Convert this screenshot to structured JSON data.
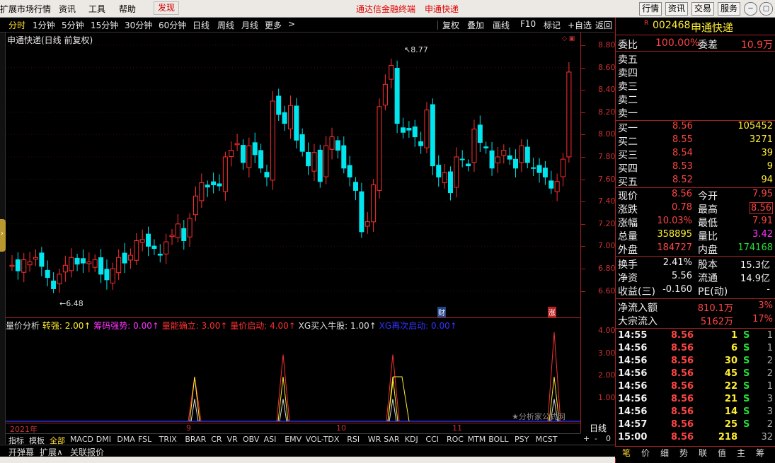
{
  "menu": {
    "items": [
      "扩展市场行情",
      "资讯",
      "工具",
      "帮助"
    ],
    "discover": "发现",
    "center_left": "通达信金融终端",
    "center_right": "申通快递",
    "right_buttons": [
      "行情",
      "资讯",
      "交易",
      "服务"
    ]
  },
  "periods": [
    "分时",
    "1分钟",
    "5分钟",
    "15分钟",
    "30分钟",
    "60分钟",
    "日线",
    "周线",
    "月线",
    "更多"
  ],
  "period_more_arrow": ">",
  "tools": [
    "复权",
    "叠加",
    "画线",
    "F10",
    "标记",
    "+自选",
    "返回"
  ],
  "chart_title": "申通快递(日线 前复权)",
  "high_label": "8.77",
  "low_label": "6.48",
  "cai_tag": "财",
  "zhang_tag": "涨",
  "indicator": {
    "name": "量价分析",
    "items": [
      {
        "label": "转强: 2.00",
        "color": "#ffee33"
      },
      {
        "label": "筹码强势: 0.00",
        "color": "#ff33ff"
      },
      {
        "label": "量能确立: 3.00",
        "color": "#ff3030"
      },
      {
        "label": "量价启动: 4.00",
        "color": "#ff3030"
      },
      {
        "label": "XG买入牛股: 1.00",
        "color": "#dddddd"
      },
      {
        "label": "XG再次启动: 0.00",
        "color": "#3333ff"
      }
    ],
    "watermark": "★分析家公式网"
  },
  "axis_main": [
    "8.80",
    "8.60",
    "8.40",
    "8.20",
    "8.00",
    "7.80",
    "7.60",
    "7.40",
    "7.20",
    "7.00",
    "6.80",
    "6.60"
  ],
  "axis_ind": [
    "4.00",
    "3.00",
    "2.00",
    "1.00"
  ],
  "dates": [
    "2021年",
    "9",
    "10",
    "11"
  ],
  "period_label": "日线",
  "tabs": [
    "指标",
    "模板",
    "全部",
    "MACD",
    "DMI",
    "DMA",
    "FSL",
    "TRIX",
    "BRAR",
    "CR",
    "VR",
    "OBV",
    "ASI",
    "EMV",
    "VOL-TDX",
    "RSI",
    "WR",
    "SAR",
    "KDJ",
    "CCI",
    "ROC",
    "MTM",
    "BOLL",
    "PSY",
    "MCST"
  ],
  "tab_controls": [
    "+",
    "-",
    "0"
  ],
  "bottom_buttons": [
    "开弹幕",
    "扩展∧",
    "关联报价"
  ],
  "stock": {
    "r_flag": "R",
    "code": "002468",
    "name": "申通快递"
  },
  "weibi": {
    "label": "委比",
    "value": "100.00%",
    "label2": "委差",
    "value2": "10.9万"
  },
  "sells": [
    "卖五",
    "卖四",
    "卖三",
    "卖二",
    "卖一"
  ],
  "buys": [
    {
      "label": "买一",
      "price": "8.56",
      "vol": "105452"
    },
    {
      "label": "买二",
      "price": "8.55",
      "vol": "3271"
    },
    {
      "label": "买三",
      "price": "8.54",
      "vol": "39"
    },
    {
      "label": "买四",
      "price": "8.53",
      "vol": "9"
    },
    {
      "label": "买五",
      "price": "8.52",
      "vol": "94"
    }
  ],
  "quote": [
    {
      "l1": "现价",
      "v1": "8.56",
      "c1": "red",
      "l2": "今开",
      "v2": "7.95",
      "c2": "red"
    },
    {
      "l1": "涨跌",
      "v1": "0.78",
      "c1": "red",
      "l2": "最高",
      "v2": "8.56",
      "c2": "red"
    },
    {
      "l1": "涨幅",
      "v1": "10.03%",
      "c1": "red",
      "l2": "最低",
      "v2": "7.91",
      "c2": "red"
    },
    {
      "l1": "总量",
      "v1": "358895",
      "c1": "yellow",
      "l2": "量比",
      "v2": "3.42",
      "c2": "magenta"
    },
    {
      "l1": "外盘",
      "v1": "184727",
      "c1": "red",
      "l2": "内盘",
      "v2": "174168",
      "c2": "green"
    }
  ],
  "fund": [
    {
      "l1": "换手",
      "v1": "2.41%",
      "l2": "股本",
      "v2": "15.3亿"
    },
    {
      "l1": "净资",
      "v1": "5.56",
      "l2": "流通",
      "v2": "14.9亿"
    },
    {
      "l1": "收益(三)",
      "v1": "-0.160",
      "l2": "PE(动)",
      "v2": "-"
    }
  ],
  "flow": [
    {
      "label": "净流入额",
      "value": "810.1万",
      "pct": "3%"
    },
    {
      "label": "大宗流入",
      "value": "5162万",
      "pct": "17%"
    }
  ],
  "ticks": [
    {
      "t": "14:55",
      "p": "8.56",
      "v": "1",
      "s": "S",
      "n": "1"
    },
    {
      "t": "14:56",
      "p": "8.56",
      "v": "6",
      "s": "S",
      "n": "1"
    },
    {
      "t": "14:56",
      "p": "8.56",
      "v": "30",
      "s": "S",
      "n": "2"
    },
    {
      "t": "14:56",
      "p": "8.56",
      "v": "45",
      "s": "S",
      "n": "2"
    },
    {
      "t": "14:56",
      "p": "8.56",
      "v": "22",
      "s": "S",
      "n": "1"
    },
    {
      "t": "14:56",
      "p": "8.56",
      "v": "21",
      "s": "S",
      "n": "3"
    },
    {
      "t": "14:56",
      "p": "8.56",
      "v": "14",
      "s": "S",
      "n": "3"
    },
    {
      "t": "14:57",
      "p": "8.56",
      "v": "25",
      "s": "S",
      "n": "2"
    },
    {
      "t": "15:00",
      "p": "8.56",
      "v": "218",
      "s": "",
      "n": "32"
    }
  ],
  "rp_tabs": [
    "笔",
    "价",
    "细",
    "势",
    "联",
    "值",
    "主",
    "筹"
  ],
  "colors": {
    "up": "#ff3030",
    "down": "#00e5ee",
    "axis": "#a02020"
  }
}
